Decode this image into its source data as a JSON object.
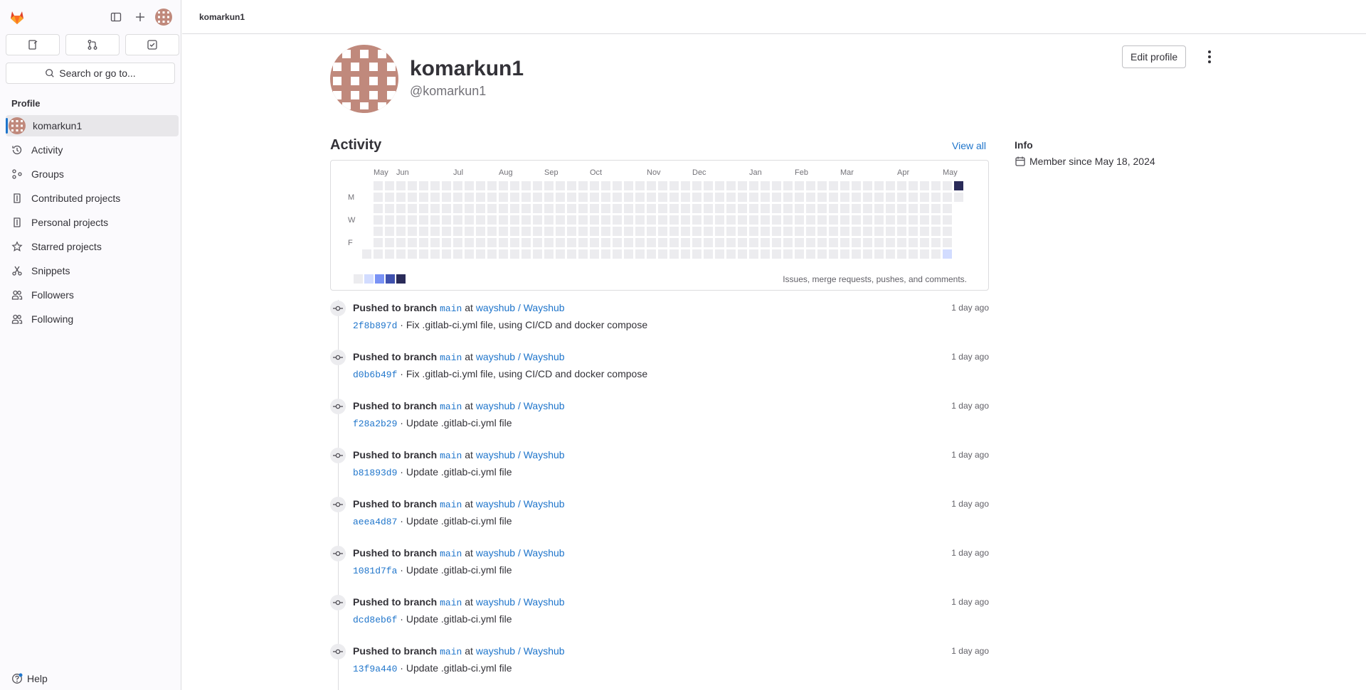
{
  "sidebar": {
    "search_label": "Search or go to...",
    "section_title": "Profile",
    "items": [
      {
        "label": "komarkun1",
        "icon": "avatar"
      },
      {
        "label": "Activity",
        "icon": "history-icon"
      },
      {
        "label": "Groups",
        "icon": "group-icon"
      },
      {
        "label": "Contributed projects",
        "icon": "project-icon"
      },
      {
        "label": "Personal projects",
        "icon": "project-icon"
      },
      {
        "label": "Starred projects",
        "icon": "star-icon"
      },
      {
        "label": "Snippets",
        "icon": "snippet-icon"
      },
      {
        "label": "Followers",
        "icon": "users-icon"
      },
      {
        "label": "Following",
        "icon": "users-icon"
      }
    ],
    "help_label": "Help"
  },
  "topbar": {
    "breadcrumb": "komarkun1"
  },
  "profile": {
    "name": "komarkun1",
    "username": "@komarkun1",
    "edit_label": "Edit profile"
  },
  "activity": {
    "title": "Activity",
    "view_all": "View all",
    "months": [
      "May",
      "Jun",
      "Jul",
      "Aug",
      "Sep",
      "Oct",
      "Nov",
      "Dec",
      "Jan",
      "Feb",
      "Mar",
      "Apr",
      "May"
    ],
    "days": [
      "M",
      "W",
      "F"
    ],
    "caption": "Issues, merge requests, pushes, and comments.",
    "legend_colors": [
      "#ececef",
      "#d2dcff",
      "#7992f5",
      "#3f51ae",
      "#2a2b59"
    ]
  },
  "info": {
    "title": "Info",
    "member_since": "Member since May 18, 2024"
  },
  "events": [
    {
      "action": "Pushed to branch",
      "branch": "main",
      "at": "at",
      "project": "wayshub / Wayshub",
      "sha": "2f8b897d",
      "message": "Fix .gitlab-ci.yml file, using CI/CD and docker compose",
      "time": "1 day ago"
    },
    {
      "action": "Pushed to branch",
      "branch": "main",
      "at": "at",
      "project": "wayshub / Wayshub",
      "sha": "d0b6b49f",
      "message": "Fix .gitlab-ci.yml file, using CI/CD and docker compose",
      "time": "1 day ago"
    },
    {
      "action": "Pushed to branch",
      "branch": "main",
      "at": "at",
      "project": "wayshub / Wayshub",
      "sha": "f28a2b29",
      "message": "Update .gitlab-ci.yml file",
      "time": "1 day ago"
    },
    {
      "action": "Pushed to branch",
      "branch": "main",
      "at": "at",
      "project": "wayshub / Wayshub",
      "sha": "b81893d9",
      "message": "Update .gitlab-ci.yml file",
      "time": "1 day ago"
    },
    {
      "action": "Pushed to branch",
      "branch": "main",
      "at": "at",
      "project": "wayshub / Wayshub",
      "sha": "aeea4d87",
      "message": "Update .gitlab-ci.yml file",
      "time": "1 day ago"
    },
    {
      "action": "Pushed to branch",
      "branch": "main",
      "at": "at",
      "project": "wayshub / Wayshub",
      "sha": "1081d7fa",
      "message": "Update .gitlab-ci.yml file",
      "time": "1 day ago"
    },
    {
      "action": "Pushed to branch",
      "branch": "main",
      "at": "at",
      "project": "wayshub / Wayshub",
      "sha": "dcd8eb6f",
      "message": "Update .gitlab-ci.yml file",
      "time": "1 day ago"
    },
    {
      "action": "Pushed to branch",
      "branch": "main",
      "at": "at",
      "project": "wayshub / Wayshub",
      "sha": "13f9a440",
      "message": "Update .gitlab-ci.yml file",
      "time": "1 day ago"
    }
  ]
}
